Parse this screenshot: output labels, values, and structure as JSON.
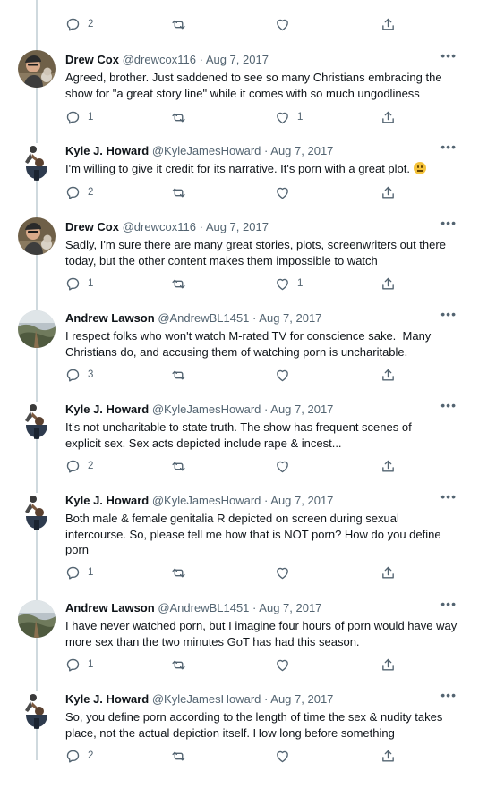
{
  "top_actions": {
    "reply_count": "2",
    "retweet_count": "",
    "like_count": ""
  },
  "tweets": [
    {
      "name": "Drew Cox",
      "handle": "@drewcox116",
      "dot": "·",
      "date": "Aug 7, 2017",
      "lines": [
        "Agreed, brother. Just saddened to see so many Christians embracing the",
        "show for \"a great story line\" while it comes with so much ungodliness"
      ],
      "reply_count": "1",
      "retweet_count": "",
      "like_count": "1",
      "more": "•••"
    },
    {
      "name": "Kyle J. Howard",
      "handle": "@KyleJamesHoward",
      "dot": "·",
      "date": "Aug 7, 2017",
      "lines": [
        "I'm willing to give it credit for its narrative. It's porn with a great plot."
      ],
      "emoji": "neutral-face-emoji",
      "reply_count": "2",
      "retweet_count": "",
      "like_count": "",
      "more": "•••"
    },
    {
      "name": "Drew Cox",
      "handle": "@drewcox116",
      "dot": "·",
      "date": "Aug 7, 2017",
      "lines": [
        "Sadly, I'm sure there are many great stories, plots, screenwriters out there",
        "today, but the other content makes them impossible to watch"
      ],
      "reply_count": "1",
      "retweet_count": "",
      "like_count": "1",
      "more": "•••"
    },
    {
      "name": "Andrew Lawson",
      "handle": "@AndrewBL1451",
      "dot": "·",
      "date": "Aug 7, 2017",
      "lines": [
        "I respect folks who won't watch M-rated TV for conscience sake.  Many",
        "Christians do, and accusing them of watching porn is uncharitable."
      ],
      "reply_count": "3",
      "retweet_count": "",
      "like_count": "",
      "more": "•••"
    },
    {
      "name": "Kyle J. Howard",
      "handle": "@KyleJamesHoward",
      "dot": "·",
      "date": "Aug 7, 2017",
      "lines": [
        "It's not uncharitable to state truth. The show has frequent scenes of",
        "explicit sex. Sex acts depicted include rape & incest..."
      ],
      "reply_count": "2",
      "retweet_count": "",
      "like_count": "",
      "more": "•••"
    },
    {
      "name": "Kyle J. Howard",
      "handle": "@KyleJamesHoward",
      "dot": "·",
      "date": "Aug 7, 2017",
      "lines": [
        "Both male & female genitalia R depicted on screen during sexual",
        "intercourse. So, please tell me how that is NOT porn? How do you define",
        "porn"
      ],
      "reply_count": "1",
      "retweet_count": "",
      "like_count": "",
      "more": "•••"
    },
    {
      "name": "Andrew Lawson",
      "handle": "@AndrewBL1451",
      "dot": "·",
      "date": "Aug 7, 2017",
      "lines": [
        "I have never watched porn, but I imagine four hours of porn would have way",
        "more sex than the two minutes GoT has had this season."
      ],
      "reply_count": "1",
      "retweet_count": "",
      "like_count": "",
      "more": "•••"
    },
    {
      "name": "Kyle J. Howard",
      "handle": "@KyleJamesHoward",
      "dot": "·",
      "date": "Aug 7, 2017",
      "lines": [
        "So, you define porn according to the length of time the sex & nudity takes",
        "place, not the actual depiction itself. How long before something"
      ],
      "reply_count": "2",
      "retweet_count": "",
      "like_count": "",
      "more": "•••"
    }
  ]
}
